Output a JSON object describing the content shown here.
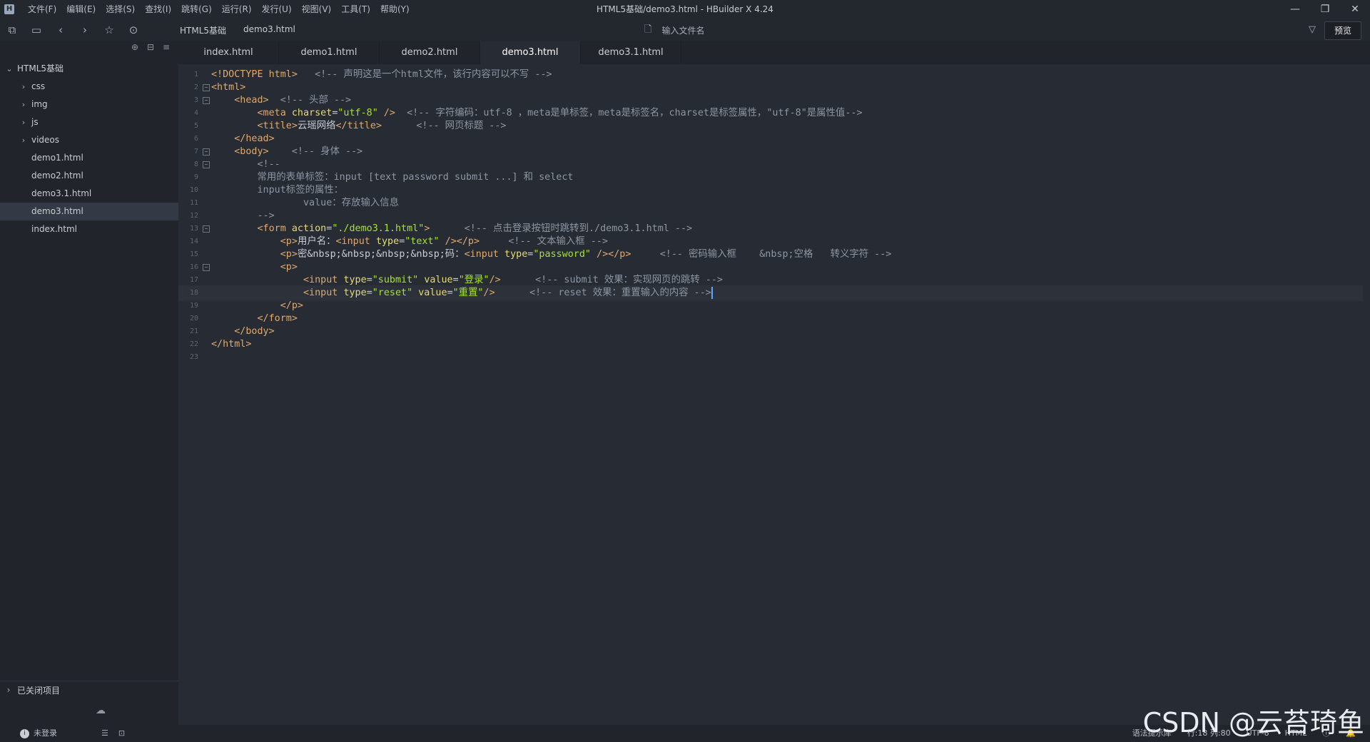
{
  "window": {
    "title": "HTML5基础/demo3.html - HBuilder X 4.24",
    "menu": [
      "文件(F)",
      "编辑(E)",
      "选择(S)",
      "查找(I)",
      "跳转(G)",
      "运行(R)",
      "发行(U)",
      "视图(V)",
      "工具(T)",
      "帮助(Y)"
    ],
    "controls": {
      "minimize": "—",
      "restore": "❐",
      "close": "✕"
    }
  },
  "toolbar": {
    "breadcrumb": [
      "HTML5基础",
      "demo3.html"
    ],
    "file_search_placeholder": "输入文件名",
    "preview_label": "预览"
  },
  "sidebar": {
    "project": "HTML5基础",
    "folders": [
      "css",
      "img",
      "js",
      "videos"
    ],
    "files": [
      "demo1.html",
      "demo2.html",
      "demo3.1.html",
      "demo3.html",
      "index.html"
    ],
    "selected_file": "demo3.html",
    "closed_projects": "已关闭项目"
  },
  "tabs": [
    {
      "label": "index.html"
    },
    {
      "label": "demo1.html"
    },
    {
      "label": "demo2.html"
    },
    {
      "label": "demo3.html",
      "active": true
    },
    {
      "label": "demo3.1.html"
    }
  ],
  "code": {
    "current_line": 18,
    "lines": [
      [
        [
          "tg",
          "<!DOCTYPE html>"
        ],
        [
          "cm",
          "   <!-- 声明这是一个html文件，该行内容可以不写 -->"
        ]
      ],
      [
        [
          "tg",
          "<html>"
        ]
      ],
      [
        [
          "tx",
          "    "
        ],
        [
          "tg",
          "<head>"
        ],
        [
          "cm",
          "  <!-- 头部 -->"
        ]
      ],
      [
        [
          "tx",
          "        "
        ],
        [
          "tg",
          "<meta "
        ],
        [
          "at",
          "charset"
        ],
        [
          "tx",
          "="
        ],
        [
          "st",
          "\"utf-8\""
        ],
        [
          "tg",
          " />"
        ],
        [
          "cm",
          "  <!-- 字符编码：utf-8 ，meta是单标签，meta是标签名，charset是标签属性，\"utf-8\"是属性值-->"
        ]
      ],
      [
        [
          "tx",
          "        "
        ],
        [
          "tg",
          "<title>"
        ],
        [
          "tx",
          "云瑶网络"
        ],
        [
          "tg",
          "</title>"
        ],
        [
          "cm",
          "      <!-- 网页标题 -->"
        ]
      ],
      [
        [
          "tx",
          "    "
        ],
        [
          "tg",
          "</head>"
        ]
      ],
      [
        [
          "tx",
          "    "
        ],
        [
          "tg",
          "<body>"
        ],
        [
          "cm",
          "    <!-- 身体 -->"
        ]
      ],
      [
        [
          "tx",
          "        "
        ],
        [
          "cm",
          "<!--"
        ]
      ],
      [
        [
          "tx",
          "        "
        ],
        [
          "cm",
          "常用的表单标签：input [text password submit ...] 和 select"
        ]
      ],
      [
        [
          "tx",
          "        "
        ],
        [
          "cm",
          "input标签的属性："
        ]
      ],
      [
        [
          "tx",
          "                "
        ],
        [
          "cm",
          "value：存放输入信息"
        ]
      ],
      [
        [
          "tx",
          "        "
        ],
        [
          "cm",
          "-->"
        ]
      ],
      [
        [
          "tx",
          "        "
        ],
        [
          "tg",
          "<form "
        ],
        [
          "at",
          "action"
        ],
        [
          "tx",
          "="
        ],
        [
          "st",
          "\"./demo3.1.html\""
        ],
        [
          "tg",
          ">"
        ],
        [
          "cm",
          "      <!-- 点击登录按钮时跳转到./demo3.1.html -->"
        ]
      ],
      [
        [
          "tx",
          "            "
        ],
        [
          "tg",
          "<p>"
        ],
        [
          "tx",
          "用户名："
        ],
        [
          "tg",
          "<input "
        ],
        [
          "at",
          "type"
        ],
        [
          "tx",
          "="
        ],
        [
          "st",
          "\"text\""
        ],
        [
          "tg",
          " /></p>"
        ],
        [
          "cm",
          "     <!-- 文本输入框 -->"
        ]
      ],
      [
        [
          "tx",
          "            "
        ],
        [
          "tg",
          "<p>"
        ],
        [
          "tx",
          "密&nbsp;&nbsp;&nbsp;&nbsp;码："
        ],
        [
          "tg",
          "<input "
        ],
        [
          "at",
          "type"
        ],
        [
          "tx",
          "="
        ],
        [
          "st",
          "\"password\""
        ],
        [
          "tg",
          " /></p>"
        ],
        [
          "cm",
          "     <!-- 密码输入框    &nbsp;空格   转义字符 -->"
        ]
      ],
      [
        [
          "tx",
          "            "
        ],
        [
          "tg",
          "<p>"
        ]
      ],
      [
        [
          "tx",
          "                "
        ],
        [
          "tg",
          "<input "
        ],
        [
          "at",
          "type"
        ],
        [
          "tx",
          "="
        ],
        [
          "st",
          "\"submit\""
        ],
        [
          "tx",
          " "
        ],
        [
          "at",
          "value"
        ],
        [
          "tx",
          "="
        ],
        [
          "st",
          "\"登录\""
        ],
        [
          "tg",
          "/>"
        ],
        [
          "cm",
          "      <!-- submit 效果：实现网页的跳转 -->"
        ]
      ],
      [
        [
          "tx",
          "                "
        ],
        [
          "tg",
          "<input "
        ],
        [
          "at",
          "type"
        ],
        [
          "tx",
          "="
        ],
        [
          "st",
          "\"reset\""
        ],
        [
          "tx",
          " "
        ],
        [
          "at",
          "value"
        ],
        [
          "tx",
          "="
        ],
        [
          "st",
          "\"重置\""
        ],
        [
          "tg",
          "/>"
        ],
        [
          "cm",
          "      <!-- reset 效果：重置输入的内容 -->"
        ]
      ],
      [
        [
          "tx",
          "            "
        ],
        [
          "tg",
          "</p>"
        ]
      ],
      [
        [
          "tx",
          "        "
        ],
        [
          "tg",
          "</form>"
        ]
      ],
      [
        [
          "tx",
          "    "
        ],
        [
          "tg",
          "</body>"
        ]
      ],
      [
        [
          "tg",
          "</html>"
        ]
      ],
      []
    ],
    "fold_lines": [
      2,
      3,
      7,
      8,
      13,
      16
    ]
  },
  "statusbar": {
    "user": "未登录",
    "hint": "语法提示库",
    "position": "行:18  列:80",
    "encoding": "UTF-8",
    "language": "HTML"
  },
  "watermark": "CSDN @云苔琦鱼",
  "colors": {
    "tag": "#e0a96d",
    "attribute": "#e6db74",
    "string": "#a6e22e",
    "comment": "#8d96a3",
    "caret": "#5aa9ff"
  }
}
